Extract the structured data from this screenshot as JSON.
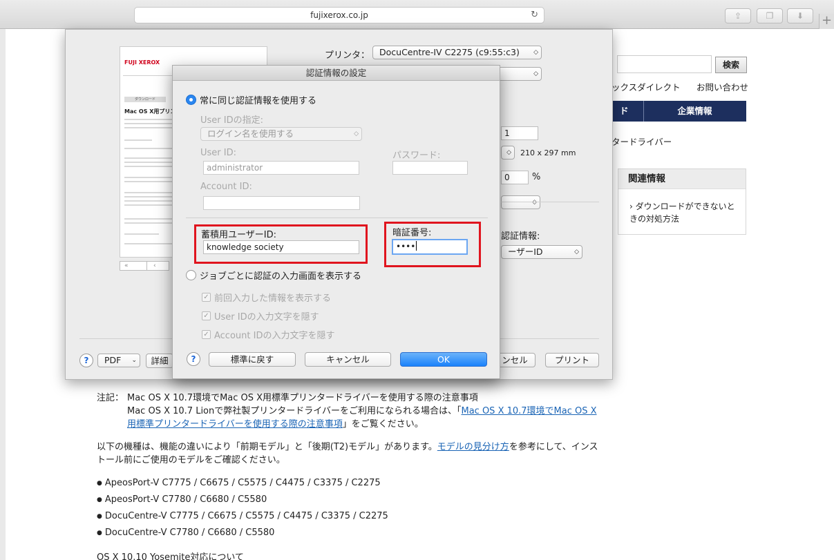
{
  "browser": {
    "url": "fujixerox.co.jp"
  },
  "site": {
    "search_button": "検索",
    "top_links": [
      "ックスダイレクト",
      "お問い合わせ"
    ],
    "nav_partial": "ド",
    "nav_company": "企業情報",
    "heading_partial": "タードライバー",
    "related_title": "関連情報",
    "related_link_line1": "ダウンロードができないと",
    "related_link_line2": "きの対処方法",
    "notes": {
      "label": "注記：",
      "line1": "Mac OS X 10.7環境でMac OS X用標準プリンタードライバーを使用する際の注意事項",
      "line2_pre": "Mac OS X 10.7 Lionで弊社製プリンタードライバーをご利用になられる場合は、「",
      "line2_link": "Mac OS X 10.7環境でMac OS X用標準プリンタードライバーを使用する際の注意事項",
      "line2_post": "」をご覧ください。",
      "para_pre": "以下の機種は、機能の違いにより「前期モデル」と「後期(T2)モデル」があります。",
      "para_link": "モデルの見分け方",
      "para_post": "を参考にして、インストール前にご使用のモデルをご確認ください。",
      "models": [
        "ApeosPort-V C7775 / C6675 / C5575 / C4475 / C3375 / C2275",
        "ApeosPort-V C7780 / C6680 / C5580",
        "DocuCentre-V C7775 / C6675 / C5575 / C4475 / C3375 / C2275",
        "DocuCentre-V C7780 / C6680 / C5580"
      ],
      "bottom_line": "OS X 10.10 Yosemite対応について"
    }
  },
  "print_sheet": {
    "preview": {
      "logo": "FUJI XEROX",
      "download_label": "ダウンロード",
      "heading": "Mac OS X用プリンタード"
    },
    "printer_label": "プリンタ：",
    "printer_value": "DocuCentre-IV C2275 (c9:55:c3)",
    "copies_partial": "1",
    "paper_size": "210 x 297 mm",
    "scale_partial": "0",
    "percent": "%",
    "auth_label_partial": "認証情報:",
    "auth_value_partial": "ーザーID",
    "pdf_label": "PDF",
    "details_partial": "詳細",
    "cancel_partial": "ンセル",
    "print_button": "プリント",
    "help": "?"
  },
  "dialog": {
    "title": "認証情報の設定",
    "option_same": "常に同じ認証情報を使用する",
    "userid_spec_label": "User IDの指定:",
    "userid_spec_value": "ログイン名を使用する",
    "userid_label": "User ID:",
    "userid_value": "administrator",
    "password_label": "パスワード:",
    "password_value": "",
    "account_label": "Account ID:",
    "account_value": "",
    "storage_user_label": "蓄積用ユーザーID:",
    "storage_user_value": "knowledge society",
    "pin_label": "暗証番号:",
    "pin_value": "••••",
    "option_per_job": "ジョブごとに認証の入力画面を表示する",
    "check_prev": "前回入力した情報を表示する",
    "check_hide_user": "User IDの入力文字を隠す",
    "check_hide_account": "Account IDの入力文字を隠す",
    "check_mark": "✓",
    "help": "?",
    "btn_default": "標準に戻す",
    "btn_cancel": "キャンセル",
    "btn_ok": "OK",
    "highlight_color": "#e0141e",
    "accent_color": "#1a82fb"
  }
}
